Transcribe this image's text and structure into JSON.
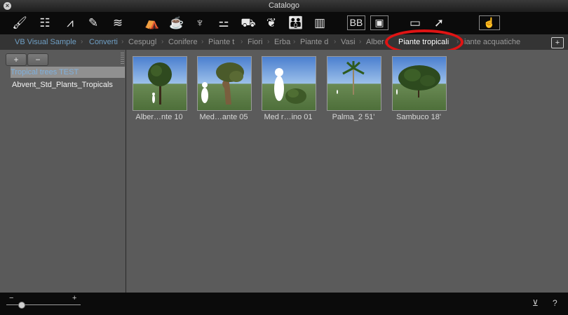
{
  "window": {
    "title": "Catalogo",
    "close_glyph": "×"
  },
  "toolbar": {
    "icons": [
      "paint-roller-icon",
      "wall-icon",
      "road-icon",
      "brush-icon",
      "water-waves-icon",
      "sofa-icon",
      "cup-icon",
      "lamp-icon",
      "table-chairs-icon",
      "car-icon",
      "plant-leaf-icon",
      "people-icon",
      "building-icon",
      "billboard-icon",
      "image-frame-icon",
      "folder-icon",
      "pointer-arrow-icon",
      "hand-cursor-icon"
    ],
    "billboard_text": "BB"
  },
  "categories": {
    "items": [
      "VB Visual Sample",
      "Converti",
      "Cespugl",
      "Conifere",
      "Piante t",
      "Fiori",
      "Erba",
      "Piante d",
      "Vasi",
      "Alber",
      "Piante tropicali",
      "iante acquatiche"
    ],
    "active_index": 10
  },
  "sidebar": {
    "add_label": "+",
    "remove_label": "−",
    "items": [
      {
        "label": "Tropical trees TEST",
        "selected": true
      },
      {
        "label": "Abvent_Std_Plants_Tropicals",
        "selected": false
      }
    ]
  },
  "thumbnails": [
    {
      "label": "Alber…nte 10"
    },
    {
      "label": "Med…ante 05"
    },
    {
      "label": "Med r…ino 01"
    },
    {
      "label": "Palma_2 51'"
    },
    {
      "label": "Sambuco 18'"
    }
  ],
  "statusbar": {
    "zoom_minus": "−",
    "zoom_plus": "+",
    "zoom_level_fraction": 0.2,
    "help_label": "?"
  },
  "colors": {
    "highlight_ring": "#e01414",
    "selected_text": "#7fb0dd"
  }
}
